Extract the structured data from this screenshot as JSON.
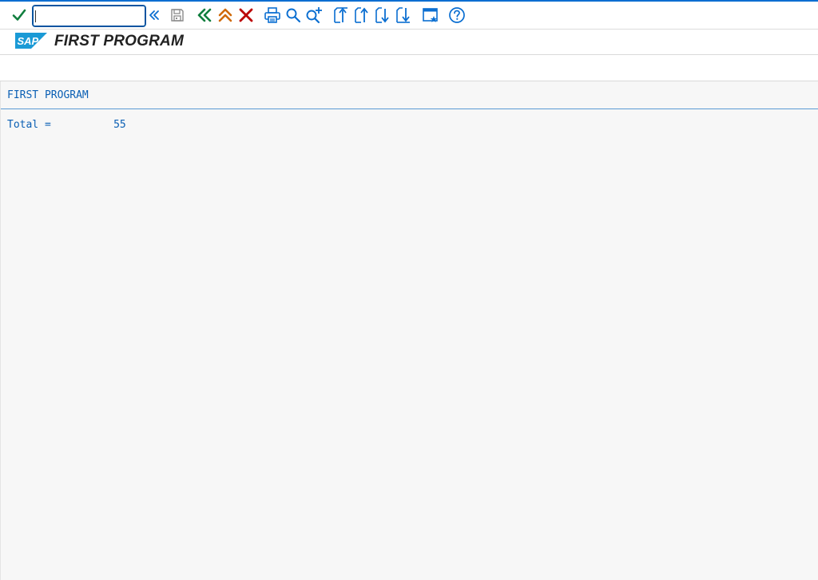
{
  "toolbar": {
    "command_field": {
      "value": "",
      "placeholder": ""
    },
    "buttons": [
      {
        "name": "enter",
        "icon": "check-icon",
        "color": "#107e3e"
      },
      {
        "name": "back-nav",
        "icon": "double-chevron-left-icon",
        "color": "#0a6ed1"
      },
      {
        "name": "save",
        "icon": "floppy-disk-icon",
        "color": "#8a8a8a"
      },
      {
        "name": "back",
        "icon": "double-chevron-left-icon",
        "color": "#107e3e"
      },
      {
        "name": "exit",
        "icon": "double-chevron-up-icon",
        "color": "#d06a0a"
      },
      {
        "name": "cancel",
        "icon": "close-icon",
        "color": "#bb0000"
      },
      {
        "name": "print",
        "icon": "printer-icon",
        "color": "#0a6ed1"
      },
      {
        "name": "find",
        "icon": "search-icon",
        "color": "#0a6ed1"
      },
      {
        "name": "find-next",
        "icon": "search-plus-icon",
        "color": "#0a6ed1"
      },
      {
        "name": "first-page",
        "icon": "first-page-icon",
        "color": "#0a6ed1"
      },
      {
        "name": "previous-page",
        "icon": "previous-page-icon",
        "color": "#0a6ed1"
      },
      {
        "name": "next-page",
        "icon": "next-page-icon",
        "color": "#0a6ed1"
      },
      {
        "name": "last-page",
        "icon": "last-page-icon",
        "color": "#0a6ed1"
      },
      {
        "name": "create-shortcut",
        "icon": "new-window-star-icon",
        "color": "#0a6ed1"
      },
      {
        "name": "help",
        "icon": "help-circle-icon",
        "color": "#0a6ed1"
      }
    ]
  },
  "title_bar": {
    "logo_text": "SAP",
    "title": "FIRST PROGRAM"
  },
  "list": {
    "header": "FIRST PROGRAM",
    "lines": [
      {
        "label": "Total =",
        "value": "55"
      }
    ]
  },
  "colors": {
    "accent": "#0a6ed1",
    "list_text": "#0a5fb4",
    "sap_logo": "#1a9ad6"
  }
}
